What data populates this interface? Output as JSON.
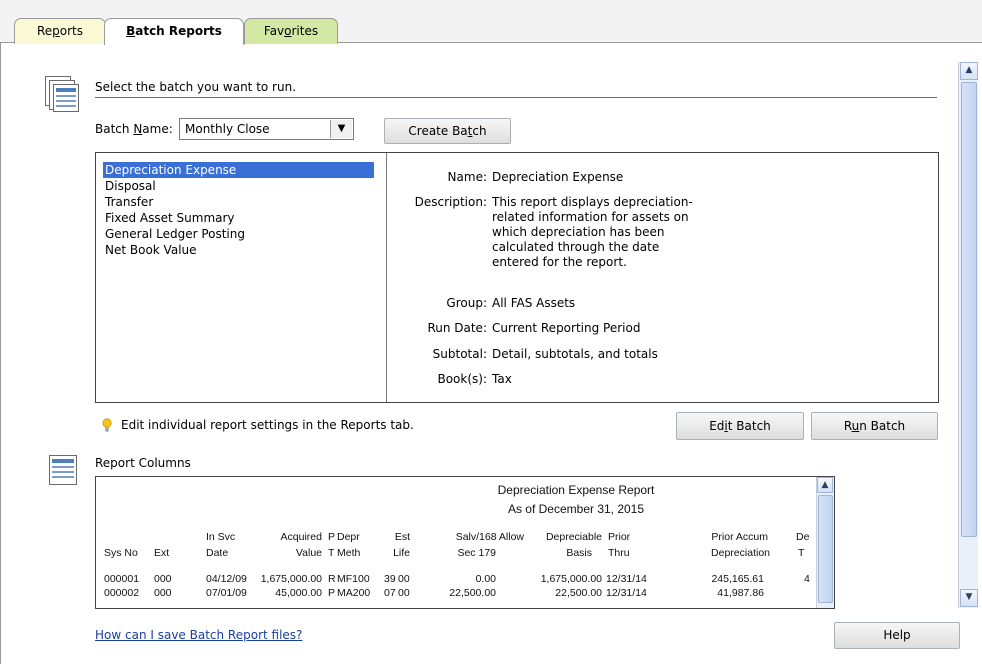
{
  "tabs": [
    {
      "label_pre": "Re",
      "label_u": "p",
      "label_post": "orts"
    },
    {
      "label_pre": "",
      "label_u": "B",
      "label_post": "atch Reports"
    },
    {
      "label_pre": "Fav",
      "label_u": "o",
      "label_post": "rites"
    }
  ],
  "batch_section": {
    "instruction": "Select the batch you want to run.",
    "batch_name_label_pre": "Batch ",
    "batch_name_label_u": "N",
    "batch_name_label_post": "ame:",
    "batch_name_value": "Monthly Close",
    "create_batch_pre": "Create Ba",
    "create_batch_u": "t",
    "create_batch_post": "ch"
  },
  "batch_list": [
    "Depreciation Expense",
    "Disposal",
    "Transfer",
    "Fixed Asset Summary",
    "General Ledger Posting",
    "Net Book Value"
  ],
  "selected_index": 0,
  "details": {
    "name_label": "Name:",
    "name_value": "Depreciation Expense",
    "description_label": "Description:",
    "description_lines": [
      "This report displays depreciation-",
      "related information for assets on",
      "which depreciation has been",
      "calculated through the date",
      "entered for the report."
    ],
    "group_label": "Group:",
    "group_value": "All FAS Assets",
    "run_date_label": "Run Date:",
    "run_date_value": "Current Reporting Period",
    "subtotal_label": "Subtotal:",
    "subtotal_value": "Detail, subtotals, and totals",
    "books_label": "Book(s):",
    "books_value": "Tax"
  },
  "tip_text": "Edit individual report settings in the Reports tab.",
  "edit_batch_pre": "Ed",
  "edit_batch_u": "i",
  "edit_batch_post": "t Batch",
  "run_batch_pre": "R",
  "run_batch_u": "u",
  "run_batch_post": "n Batch",
  "report_columns_label": "Report Columns",
  "report_preview": {
    "title": "Depreciation Expense Report",
    "subtitle": "As of December 31, 2015",
    "header_top": [
      "In Svc",
      "Acquired",
      "P",
      "Depr",
      "Est",
      "Salv/168 Allow",
      "Depreciable",
      "Prior",
      "Prior Accum",
      "De"
    ],
    "header_bottom": [
      "Sys No",
      "Ext",
      "Date",
      "Value",
      "T",
      "Meth",
      "Life",
      "Sec 179",
      "Basis",
      "Thru",
      "Depreciation",
      "T"
    ],
    "rows": [
      [
        "000001",
        "000",
        "04/12/09",
        "1,675,000.00",
        "R",
        "MF100",
        "39",
        "00",
        "0.00",
        "1,675,000.00",
        "12/31/14",
        "245,165.61",
        "4"
      ],
      [
        "000002",
        "000",
        "07/01/09",
        "45,000.00",
        "P",
        "MA200",
        "07",
        "00",
        "22,500.00",
        "22,500.00",
        "12/31/14",
        "41,987.86",
        ""
      ]
    ]
  },
  "help_link": "How can I save Batch Report files?",
  "help_button": "Help"
}
